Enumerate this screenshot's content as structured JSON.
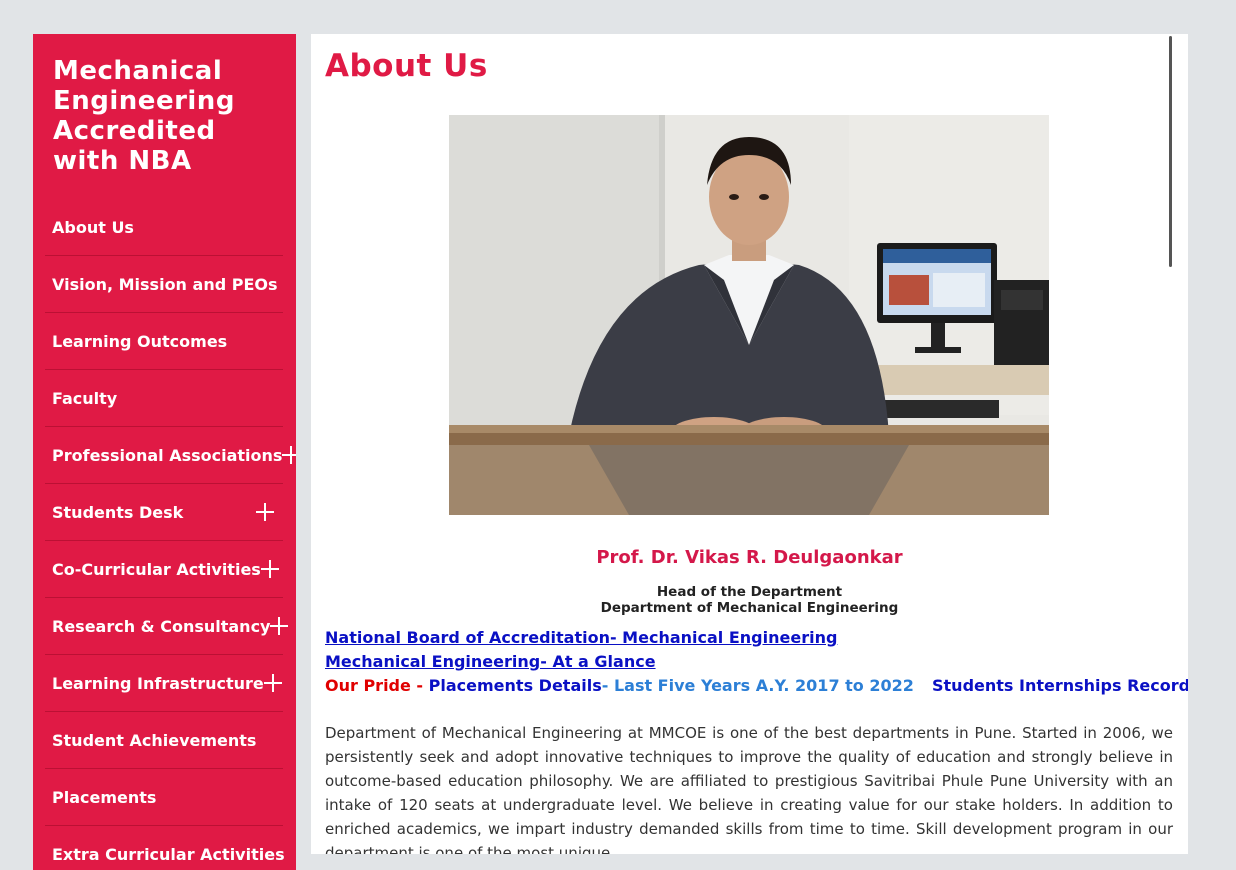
{
  "sidebar": {
    "title": "Mechanical Engineering Accredited with NBA",
    "items": [
      {
        "label": "About Us"
      },
      {
        "label": "Vision, Mission and PEOs"
      },
      {
        "label": "Learning Outcomes"
      },
      {
        "label": "Faculty"
      },
      {
        "label": "Professional Associations",
        "icon": "plus-icon"
      },
      {
        "label": "Students Desk",
        "icon": "plus-icon"
      },
      {
        "label": "Co-Curricular Activities",
        "icon": "plus-icon"
      },
      {
        "label": "Research & Consultancy",
        "icon": "plus-icon"
      },
      {
        "label": "Learning Infrastructure",
        "icon": "plus-icon"
      },
      {
        "label": "Student Achievements"
      },
      {
        "label": "Placements"
      },
      {
        "label": "Extra Curricular Activities"
      }
    ]
  },
  "main": {
    "title": "About Us",
    "person": {
      "name": "Prof. Dr. Vikas R. Deulgaonkar",
      "role": "Head of the Department",
      "department": "Department of Mechanical Engineering"
    },
    "links": {
      "nba": "National Board of Accreditation- Mechanical Engineering",
      "glance": "Mechanical Engineering- At a Glance",
      "pride_label": "Our Pride -",
      "placements": "Placements Details",
      "years": "- Last Five Years A.Y. 2017 to 2022",
      "internships": "Students Internships Record"
    },
    "paragraph": "Department of Mechanical Engineering at MMCOE is one of the best departments in Pune. Started in 2006, we persistently seek and adopt innovative techniques to improve the quality of education and strongly believe in outcome-based education philosophy. We are affiliated to prestigious Savitribai Phule Pune University with an intake of 120 seats at undergraduate level. We believe in creating value for our stake holders. In addition to enriched academics, we impart industry demanded skills from time to time. Skill development program in our department is one of the most unique"
  },
  "colors": {
    "brand": "#e01a45",
    "link": "#0a10c4",
    "pride": "#e00000",
    "years": "#2c7fd6"
  }
}
